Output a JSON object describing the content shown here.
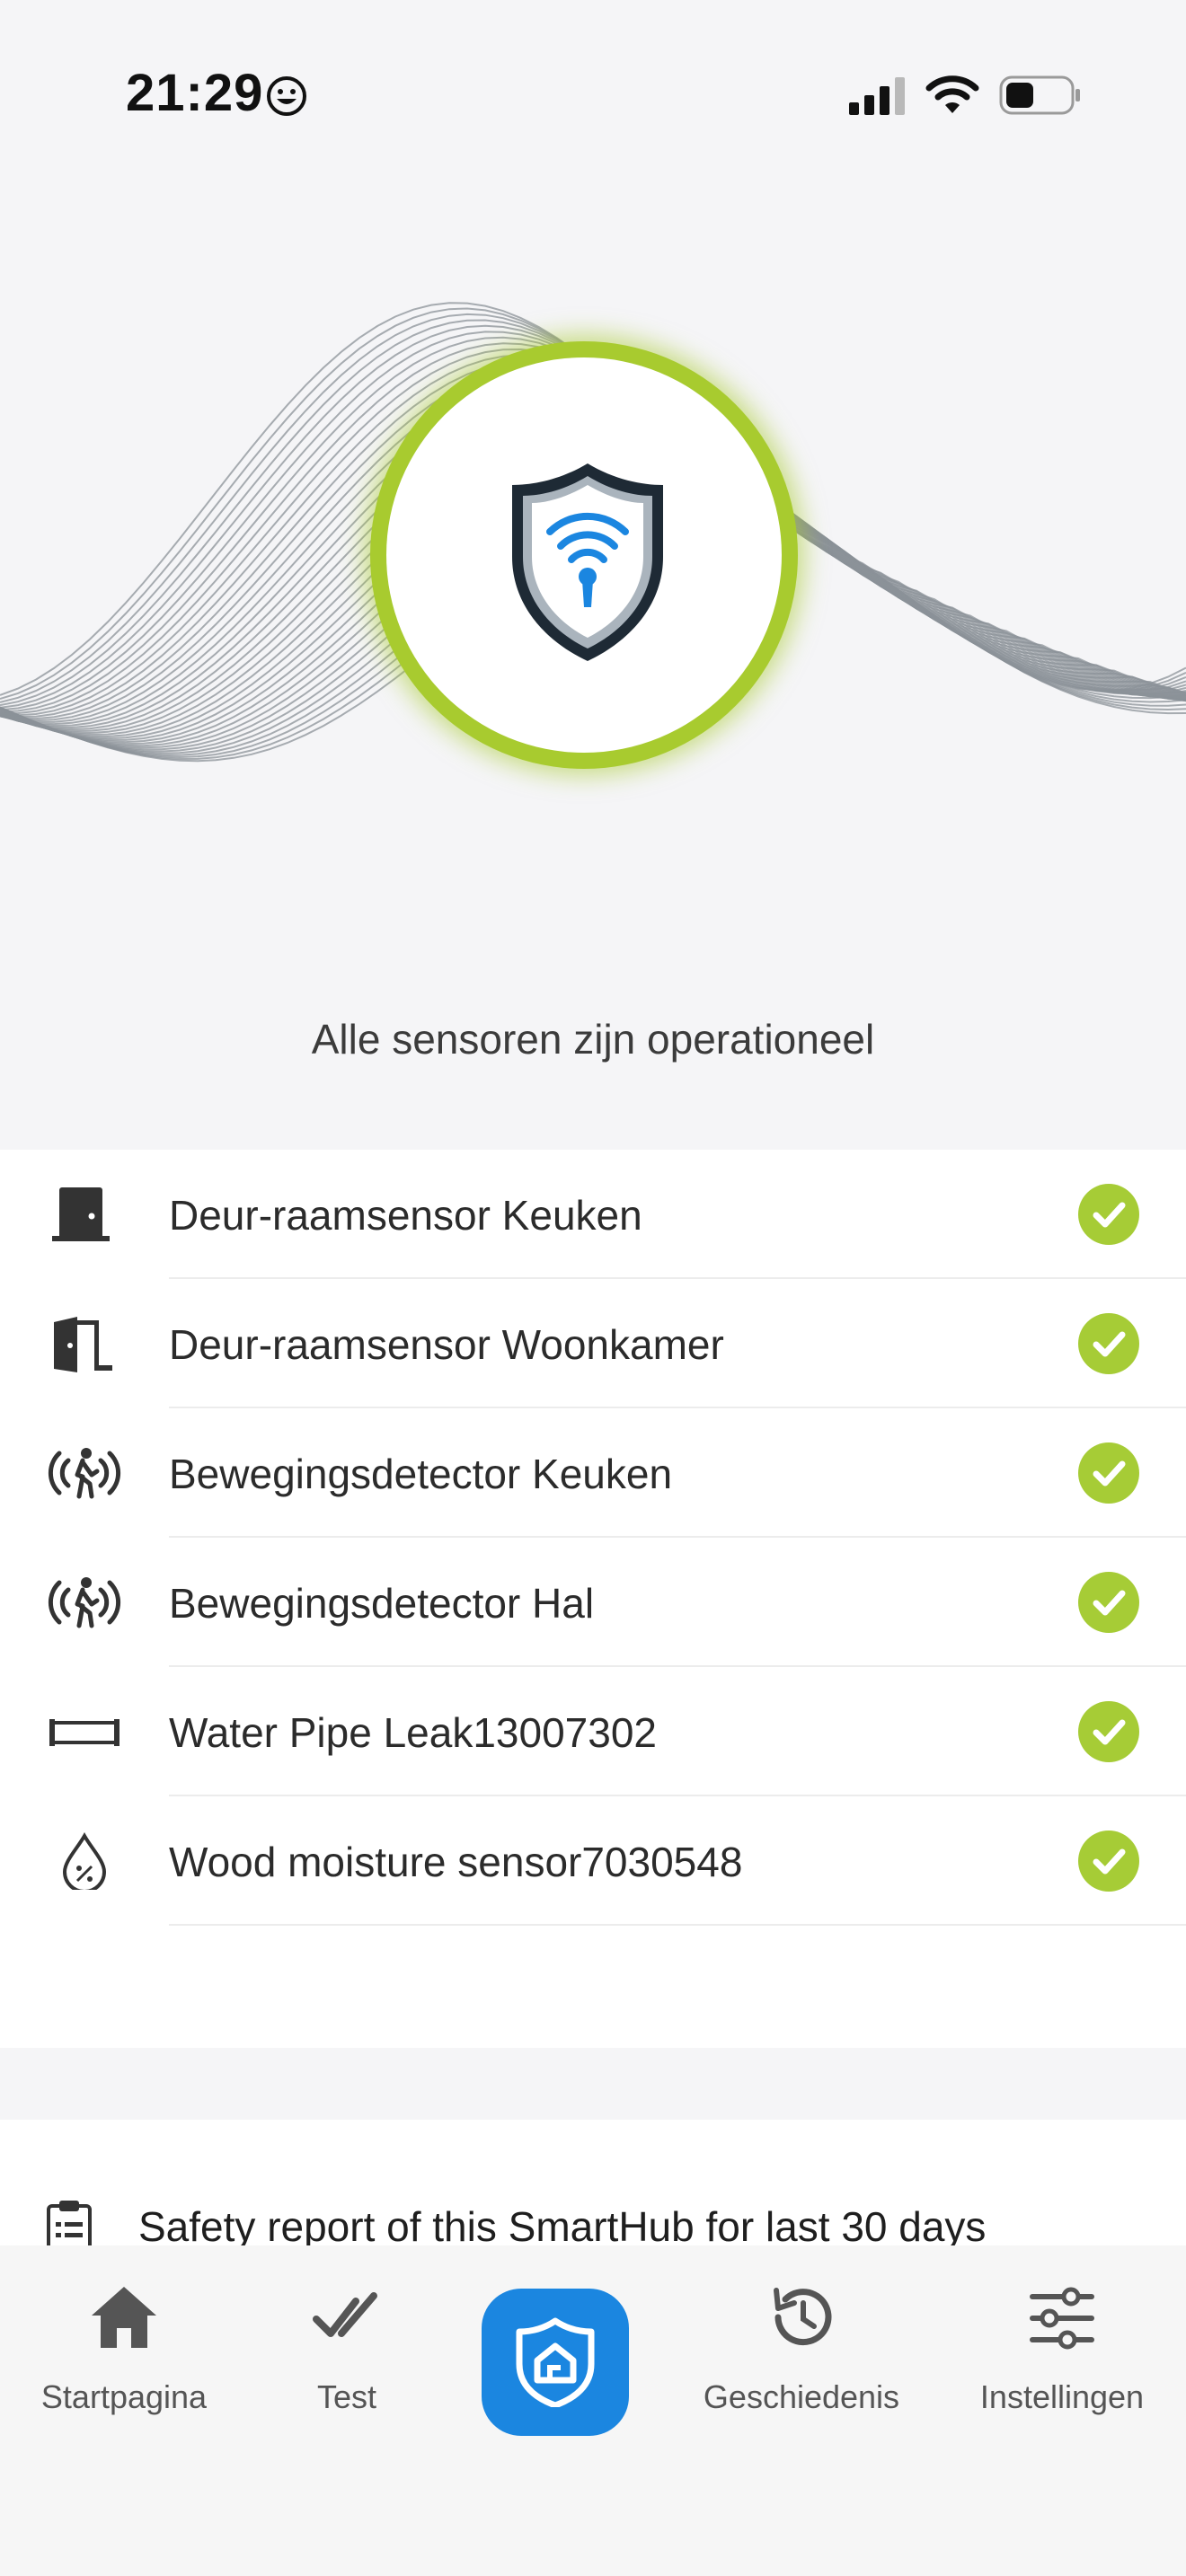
{
  "status_bar": {
    "time": "21:29",
    "icons": [
      "smiley-icon",
      "cellular-signal-icon",
      "wifi-icon",
      "battery-icon"
    ]
  },
  "hero": {
    "accent_color": "#a8cb2f",
    "logo": "security-shield-keyhole-icon",
    "status_message": "Alle sensoren zijn operationeel"
  },
  "sensors": [
    {
      "label": "Deur-raamsensor Keuken",
      "icon": "door-icon",
      "status": "ok"
    },
    {
      "label": "Deur-raamsensor Woonkamer",
      "icon": "door-open-icon",
      "status": "ok"
    },
    {
      "label": "Bewegingsdetector Keuken",
      "icon": "motion-icon",
      "status": "ok"
    },
    {
      "label": "Bewegingsdetector Hal",
      "icon": "motion-icon",
      "status": "ok"
    },
    {
      "label": "Water Pipe Leak13007302",
      "icon": "pipe-icon",
      "status": "ok"
    },
    {
      "label": "Wood moisture sensor7030548",
      "icon": "moisture-drop-icon",
      "status": "ok"
    }
  ],
  "report": {
    "label": "Safety report of this SmartHub for last 30 days",
    "icon": "clipboard-icon"
  },
  "tab_bar": {
    "tabs": [
      {
        "label": "Startpagina",
        "icon": "home-icon"
      },
      {
        "label": "Test",
        "icon": "double-check-icon"
      },
      {
        "label": "",
        "icon": "shield-home-icon",
        "active": true
      },
      {
        "label": "Geschiedenis",
        "icon": "history-icon"
      },
      {
        "label": "Instellingen",
        "icon": "sliders-icon"
      }
    ],
    "active_color": "#1b86e0"
  }
}
